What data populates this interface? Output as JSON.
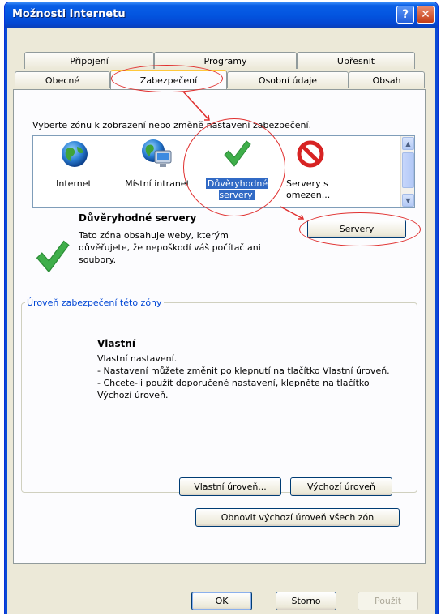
{
  "window": {
    "title": "Možnosti Internetu",
    "help": "?",
    "close": "✕"
  },
  "tabs": {
    "row1": [
      "Připojení",
      "Programy",
      "Upřesnit"
    ],
    "row2": [
      "Obecné",
      "Zabezpečení",
      "Osobní údaje",
      "Obsah"
    ],
    "active": "Zabezpečení"
  },
  "instruction": "Vyberte zónu k zobrazení nebo změně nastavení zabezpečení.",
  "zones": [
    {
      "label": "Internet",
      "icon": "globe-icon"
    },
    {
      "label": "Místní intranet",
      "icon": "intranet-icon"
    },
    {
      "label": "Důvěryhodné servery",
      "icon": "checkmark-icon",
      "selected": true
    },
    {
      "label": "Servery s omezen...",
      "icon": "restricted-icon"
    }
  ],
  "zone_info": {
    "title": "Důvěryhodné servery",
    "description": "Tato zóna obsahuje weby, kterým důvěřujete, že nepoškodí váš počítač ani soubory."
  },
  "sites_button": "Servery",
  "security_level": {
    "group_title": "Úroveň zabezpečení této zóny",
    "level_title": "Vlastní",
    "line1": "Vlastní nastavení.",
    "line2": "- Nastavení můžete změnit po klepnutí na tlačítko Vlastní úroveň.",
    "line3": "- Chcete-li použít doporučené nastavení, klepněte na tlačítko Výchozí úroveň."
  },
  "buttons": {
    "custom_level": "Vlastní úroveň...",
    "default_level": "Výchozí úroveň",
    "reset_all": "Obnovit výchozí úroveň všech zón",
    "ok": "OK",
    "cancel": "Storno",
    "apply": "Použít"
  },
  "colors": {
    "accent": "#0046d5",
    "annotation": "#e0302f",
    "selection": "#316ac5"
  }
}
